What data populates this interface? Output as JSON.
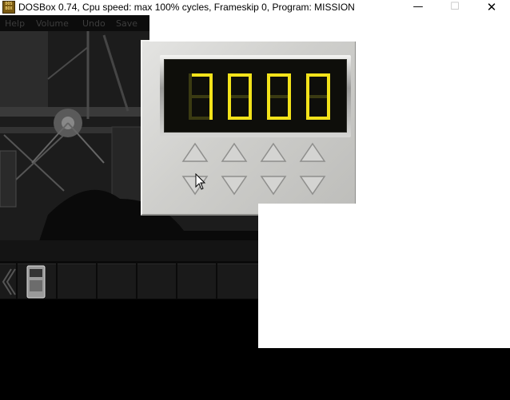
{
  "window": {
    "title": "DOSBox 0.74, Cpu speed: max 100% cycles, Frameskip  0, Program:  MISSION",
    "icon_text": [
      "DOS",
      "BOX"
    ],
    "minimize_glyph": "—",
    "maximize_glyph": "☐",
    "close_glyph": "✕"
  },
  "menu": {
    "items": [
      "Help",
      "Volume",
      "Undo",
      "Save"
    ]
  },
  "combination_lock": {
    "digits": [
      "7",
      "0",
      "0",
      "0"
    ],
    "colors": {
      "lit": "#f2e21a",
      "dim": "#3a3a12",
      "screen": "#0e0e0a"
    }
  },
  "inventory": {
    "item_icons": [
      "scroll-left-icon",
      "handheld-device-icon"
    ]
  }
}
